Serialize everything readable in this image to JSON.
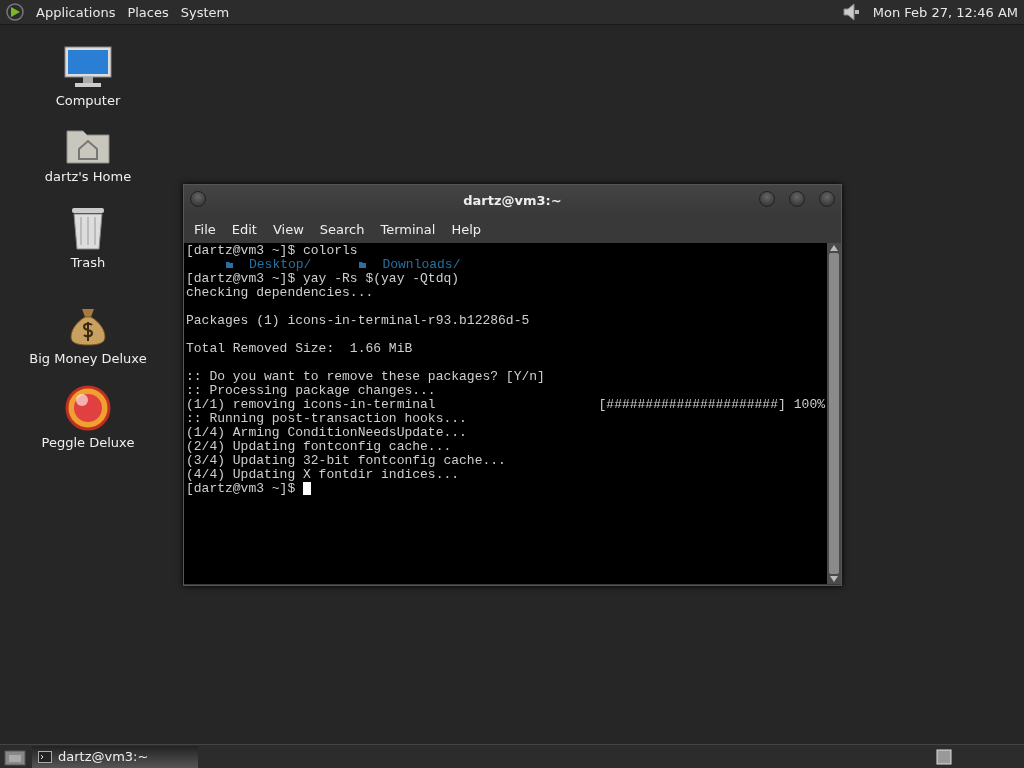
{
  "top_panel": {
    "menus": [
      "Applications",
      "Places",
      "System"
    ],
    "clock": "Mon Feb 27, 12:46 AM"
  },
  "desktop_icons": [
    {
      "kind": "computer",
      "label": "Computer"
    },
    {
      "kind": "home",
      "label": "dartz's Home"
    },
    {
      "kind": "trash",
      "label": "Trash"
    },
    {
      "kind": "money",
      "label": "Big Money Deluxe"
    },
    {
      "kind": "peggle",
      "label": "Peggle Deluxe"
    }
  ],
  "window": {
    "title": "dartz@vm3:~",
    "menu": [
      "File",
      "Edit",
      "View",
      "Search",
      "Terminal",
      "Help"
    ],
    "lines": [
      {
        "kind": "text",
        "text": "[dartz@vm3 ~]$ colorls"
      },
      {
        "kind": "listing",
        "items": [
          "Desktop/",
          "Downloads/"
        ]
      },
      {
        "kind": "text",
        "text": "[dartz@vm3 ~]$ yay -Rs $(yay -Qtdq)"
      },
      {
        "kind": "text",
        "text": "checking dependencies..."
      },
      {
        "kind": "blank"
      },
      {
        "kind": "text",
        "text": "Packages (1) icons-in-terminal-r93.b12286d-5"
      },
      {
        "kind": "blank"
      },
      {
        "kind": "text",
        "text": "Total Removed Size:  1.66 MiB"
      },
      {
        "kind": "blank"
      },
      {
        "kind": "text",
        "text": ":: Do you want to remove these packages? [Y/n]"
      },
      {
        "kind": "text",
        "text": ":: Processing package changes..."
      },
      {
        "kind": "progress",
        "text": "(1/1) removing icons-in-terminal",
        "bar": "[######################]",
        "percent": "100%"
      },
      {
        "kind": "text",
        "text": ":: Running post-transaction hooks..."
      },
      {
        "kind": "text",
        "text": "(1/4) Arming ConditionNeedsUpdate..."
      },
      {
        "kind": "text",
        "text": "(2/4) Updating fontconfig cache..."
      },
      {
        "kind": "text",
        "text": "(3/4) Updating 32-bit fontconfig cache..."
      },
      {
        "kind": "text",
        "text": "(4/4) Updating X fontdir indices..."
      },
      {
        "kind": "prompt",
        "text": "[dartz@vm3 ~]$"
      }
    ]
  },
  "taskbar": {
    "tasks": [
      {
        "label": "dartz@vm3:~",
        "selected": true
      }
    ]
  }
}
